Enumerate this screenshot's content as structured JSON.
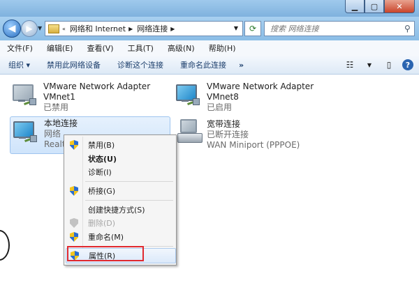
{
  "address": {
    "segments": [
      "网络和 Internet",
      "网络连接"
    ],
    "search_placeholder": "搜索 网络连接"
  },
  "menu": [
    "文件(F)",
    "编辑(E)",
    "查看(V)",
    "工具(T)",
    "高级(N)",
    "帮助(H)"
  ],
  "toolbar": {
    "organize": "组织 ▾",
    "disable": "禁用此网络设备",
    "diagnose": "诊断这个连接",
    "rename": "重命名此连接",
    "more": "»"
  },
  "connections": [
    {
      "name": "VMware Network Adapter",
      "device": "VMnet1",
      "status": "已禁用"
    },
    {
      "name": "VMware Network Adapter",
      "device": "VMnet8",
      "status": "已启用"
    },
    {
      "name": "本地连接",
      "device": "网络",
      "status": "Realt"
    },
    {
      "name": "宽带连接",
      "device": "已断开连接",
      "status": "WAN Miniport (PPPOE)"
    }
  ],
  "context_menu": [
    {
      "label": "禁用(B)"
    },
    {
      "label": "状态(U)"
    },
    {
      "label": "诊断(I)"
    },
    {
      "label": "桥接(G)"
    },
    {
      "label": "创建快捷方式(S)"
    },
    {
      "label": "删除(D)"
    },
    {
      "label": "重命名(M)"
    },
    {
      "label": "属性(R)"
    }
  ]
}
